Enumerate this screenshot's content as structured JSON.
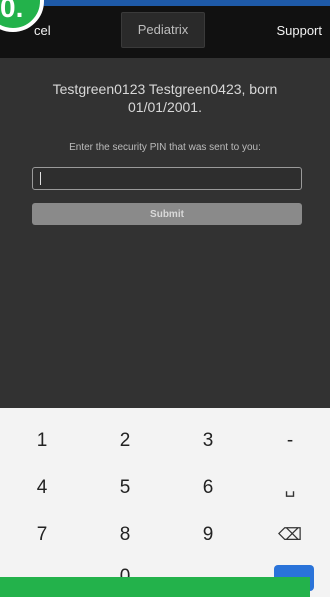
{
  "header": {
    "cancel_label": "cel",
    "title": "Pediatrix",
    "support_label": "Support"
  },
  "badge": {
    "text": "0."
  },
  "content": {
    "patient_info": "Testgreen0123 Testgreen0423, born 01/01/2001.",
    "pin_prompt": "Enter the security PIN that was sent to you:",
    "pin_value": "",
    "submit_label": "Submit"
  },
  "keypad": {
    "keys": [
      "1",
      "2",
      "3",
      "-",
      "4",
      "5",
      "6",
      "␣",
      "7",
      "8",
      "9",
      "⌫",
      "0"
    ]
  },
  "colors": {
    "brand_blue": "#1e5aa8",
    "accent_green": "#23b24b",
    "enter_blue": "#2a73d9"
  }
}
